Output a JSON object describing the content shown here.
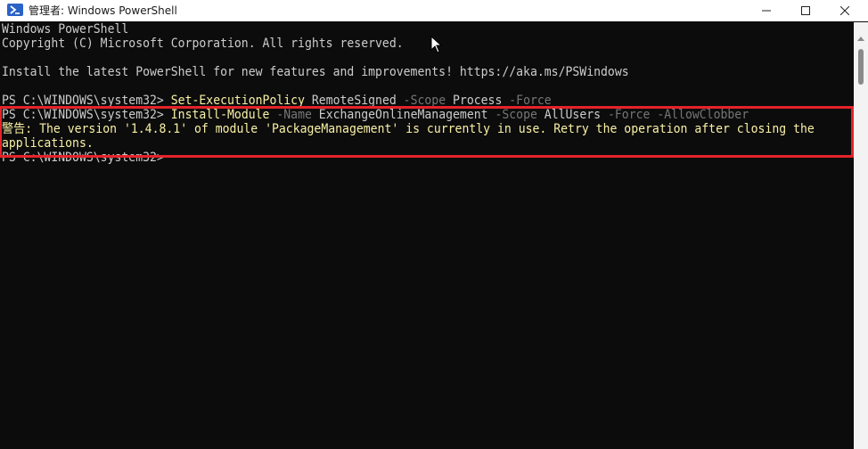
{
  "window": {
    "title": "管理者: Windows PowerShell",
    "minimize_glyph": "—",
    "maximize_glyph": "☐",
    "close_glyph": "✕"
  },
  "console": {
    "line1": "Windows PowerShell",
    "line2": "Copyright (C) Microsoft Corporation. All rights reserved.",
    "line3": "Install the latest PowerShell for new features and improvements! https://aka.ms/PSWindows",
    "line4": {
      "prompt": "PS C:\\WINDOWS\\system32> ",
      "cmdlet": "Set-ExecutionPolicy",
      "arg1": " RemoteSigned ",
      "param1": "-Scope",
      "arg2": " Process ",
      "param2": "-Force"
    },
    "line5": {
      "prompt": "PS C:\\WINDOWS\\system32> ",
      "cmdlet": "Install-Module",
      "param1": " -Name",
      "arg1": " ExchangeOnlineManagement ",
      "param2": "-Scope",
      "arg2": " AllUsers ",
      "param3": "-Force",
      "param4": " -AllowClobber"
    },
    "warning_line1": "警告: The version '1.4.8.1' of module 'PackageManagement' is currently in use. Retry the operation after closing the",
    "warning_line2": "applications.",
    "line8": "PS C:\\WINDOWS\\system32>"
  },
  "colors": {
    "background": "#0c0c0c",
    "text": "#cccccc",
    "cmdlet": "#f9f1a5",
    "parameter": "#767676",
    "warning": "#f9f1a5",
    "highlight_border": "#e5232a"
  },
  "icons": {
    "app": "powershell-icon",
    "pointer": "mouse-pointer-icon"
  }
}
